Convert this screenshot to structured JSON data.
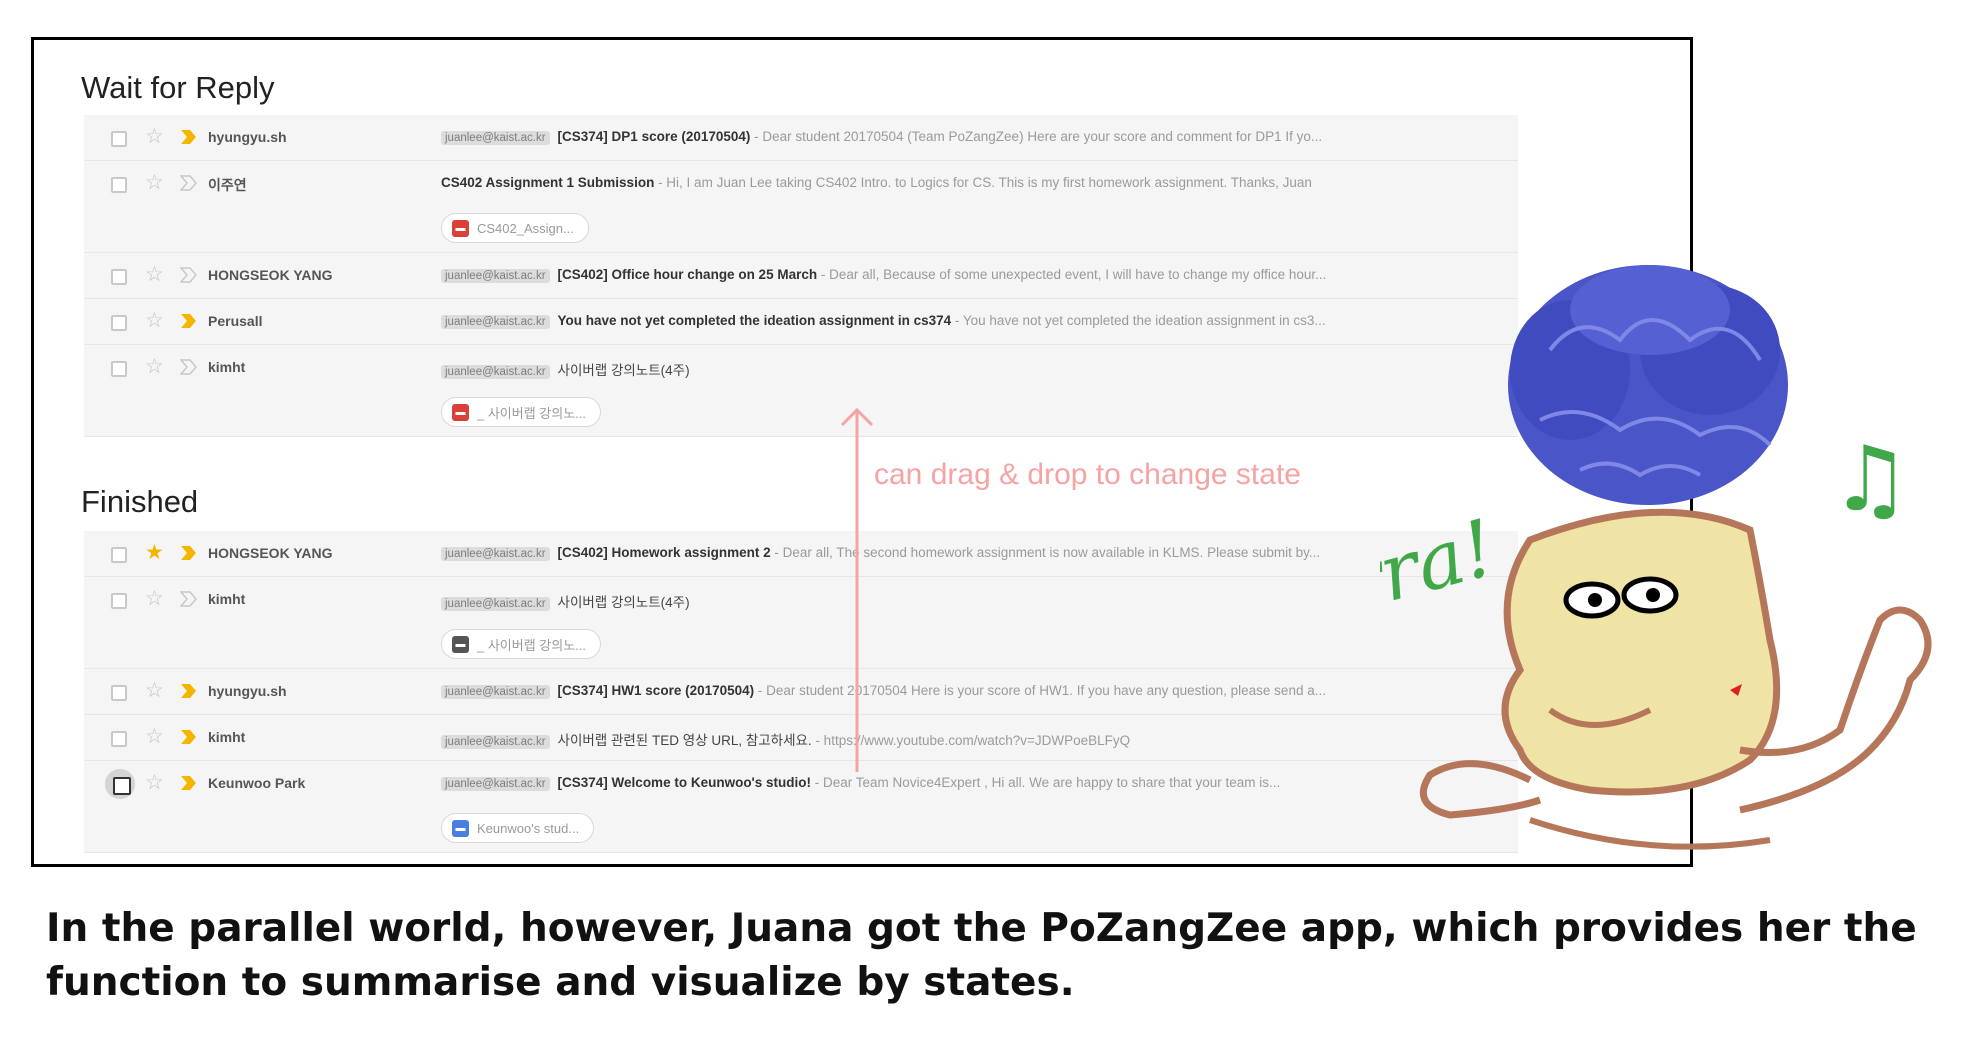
{
  "sections": [
    {
      "title": "Wait for Reply",
      "rows": [
        {
          "sender": "hyungyu.sh",
          "starred": false,
          "important": true,
          "tag": "juanlee@kaist.ac.kr",
          "subject": "[CS374] DP1 score (20170504)",
          "snippet": " - Dear student 20170504 (Team PoZangZee) Here are your score and comment for DP1 If yo..."
        },
        {
          "sender": "이주연",
          "starred": false,
          "important": false,
          "tag": "",
          "subject": "CS402 Assignment 1 Submission",
          "snippet": " - Hi, I am Juan Lee taking CS402 Intro. to Logics for CS. This is my first homework assignment. Thanks, Juan",
          "attachment": "CS402_Assign..."
        },
        {
          "sender": "HONGSEOK YANG",
          "starred": false,
          "important": false,
          "tag": "juanlee@kaist.ac.kr",
          "subject": "[CS402] Office hour change on 25 March",
          "snippet": " - Dear all, Because of some unexpected event, I will have to change my office hour..."
        },
        {
          "sender": "Perusall",
          "starred": false,
          "important": true,
          "tag": "juanlee@kaist.ac.kr",
          "subject": "You have not yet completed the ideation assignment in cs374",
          "snippet": " - You have not yet completed the ideation assignment in cs3..."
        },
        {
          "sender": "kimht",
          "starred": false,
          "important": false,
          "tag": "juanlee@kaist.ac.kr",
          "subject": "사이버랩 강의노트(4주)",
          "snippet": "",
          "attachment": "_ 사이버랩 강의노..."
        }
      ]
    },
    {
      "title": "Finished",
      "rows": [
        {
          "sender": "HONGSEOK YANG",
          "starred": true,
          "important": true,
          "tag": "juanlee@kaist.ac.kr",
          "subject": "[CS402] Homework assignment 2",
          "snippet": " - Dear all, The second homework assignment is now available in KLMS. Please submit by..."
        },
        {
          "sender": "kimht",
          "starred": false,
          "important": false,
          "tag": "juanlee@kaist.ac.kr",
          "subject": "사이버랩 강의노트(4주)",
          "snippet": "",
          "attachment": "_ 사이버랩 강의노..."
        },
        {
          "sender": "hyungyu.sh",
          "starred": false,
          "important": true,
          "tag": "juanlee@kaist.ac.kr",
          "subject": "[CS374] HW1 score (20170504)",
          "snippet": " - Dear student 20170504 Here is your score of HW1. If you have any question, please send a..."
        },
        {
          "sender": "kimht",
          "starred": false,
          "important": true,
          "tag": "juanlee@kaist.ac.kr",
          "subject": "사이버랩 관련된 TED 영상 URL, 참고하세요.",
          "snippet": " - https://www.youtube.com/watch?v=JDWPoeBLFyQ"
        },
        {
          "sender": "Keunwoo Park",
          "starred": false,
          "important": true,
          "tag": "juanlee@kaist.ac.kr",
          "subject": "[CS374] Welcome to Keunwoo's studio!",
          "snippet": " - Dear Team Novice4Expert , Hi all. We are happy to share that your team is...",
          "attachment": "Keunwoo's stud..."
        }
      ]
    }
  ],
  "drag_hint": "can drag & drop to change state",
  "doodle": {
    "exclamation": "¡Hurra!",
    "note": "♫"
  },
  "caption": "In the parallel world, however, Juana got the PoZangZee app, which provides her the function to summarise and visualize by states.",
  "colors": {
    "star": "#f4b400",
    "important": "#f4b400",
    "hint": "#f6a3a3",
    "hair": "#4a55c8",
    "face": "#efe3a6",
    "outline": "#b5765a",
    "green": "#41a84a"
  },
  "icons": {
    "checkbox": "checkbox-icon",
    "star": "star-icon",
    "important": "important-marker-icon",
    "pdf": "pdf-file-icon",
    "doc": "doc-file-icon"
  }
}
